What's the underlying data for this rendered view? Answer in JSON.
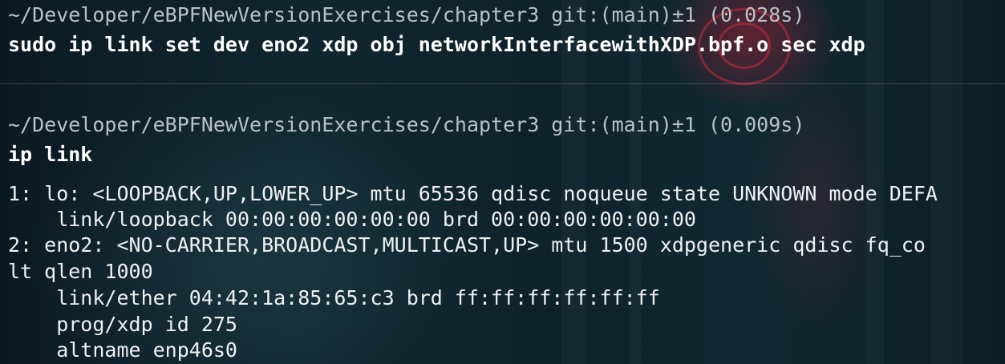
{
  "block1": {
    "prompt": "~/Developer/eBPFNewVersionExercises/chapter3 git:(main)±1 (0.028s)",
    "command": "sudo ip link set dev eno2 xdp obj networkInterfacewithXDP.bpf.o sec xdp"
  },
  "block2": {
    "prompt": "~/Developer/eBPFNewVersionExercises/chapter3 git:(main)±1 (0.009s)",
    "command": "ip link",
    "output": [
      "1: lo: <LOOPBACK,UP,LOWER_UP> mtu 65536 qdisc noqueue state UNKNOWN mode DEFA",
      "    link/loopback 00:00:00:00:00:00 brd 00:00:00:00:00:00",
      "2: eno2: <NO-CARRIER,BROADCAST,MULTICAST,UP> mtu 1500 xdpgeneric qdisc fq_co",
      "lt qlen 1000",
      "    link/ether 04:42:1a:85:65:c3 brd ff:ff:ff:ff:ff:ff",
      "    prog/xdp id 275",
      "    altname enp46s0"
    ]
  }
}
